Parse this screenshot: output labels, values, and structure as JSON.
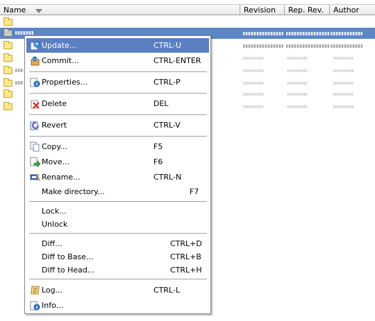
{
  "columns": {
    "name": "Name",
    "revision": "Revision",
    "rep_rev": "Rep. Rev.",
    "author": "Author"
  },
  "menu": {
    "update": {
      "label": "Update...",
      "shortcut": "CTRL-U"
    },
    "commit": {
      "label": "Commit...",
      "shortcut": "CTRL-ENTER"
    },
    "properties": {
      "label": "Properties...",
      "shortcut": "CTRL-P"
    },
    "delete": {
      "label": "Delete",
      "shortcut": "DEL"
    },
    "revert": {
      "label": "Revert",
      "shortcut": "CTRL-V"
    },
    "copy": {
      "label": "Copy...",
      "shortcut": "F5"
    },
    "move": {
      "label": "Move...",
      "shortcut": "F6"
    },
    "rename": {
      "label": "Rename...",
      "shortcut": "CTRL-N"
    },
    "make_directory": {
      "label": "Make directory...",
      "shortcut": "F7"
    },
    "lock": {
      "label": "Lock..."
    },
    "unlock": {
      "label": "Unlock"
    },
    "diff": {
      "label": "Diff...",
      "shortcut": "CTRL+D"
    },
    "diff_to_base": {
      "label": "Diff to Base...",
      "shortcut": "CTRL+B"
    },
    "diff_to_head": {
      "label": "Diff to Head...",
      "shortcut": "CTRL+H"
    },
    "log": {
      "label": "Log...",
      "shortcut": "CTRL-L"
    },
    "info": {
      "label": "Info..."
    }
  },
  "colors": {
    "selection": "#5c86c6",
    "menu_highlight": "#5a80c2",
    "folder": "#fde98a"
  }
}
